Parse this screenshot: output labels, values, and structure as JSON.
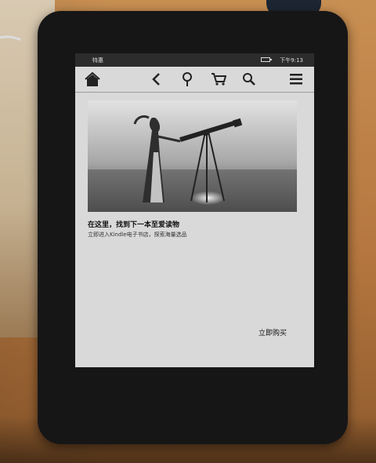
{
  "status_bar": {
    "label_left": "特惠",
    "time": "下午9:13"
  },
  "toolbar": {
    "icons": [
      "home-icon",
      "back-icon",
      "goodreads-icon",
      "cart-icon",
      "search-icon",
      "menu-icon"
    ]
  },
  "promo": {
    "headline": "在这里，找到下一本至爱读物",
    "subline": "立即进入Kindle电子书店，探索海量选品",
    "buy_label": "立即购买"
  },
  "colors": {
    "screen_bg": "#d9d9d9",
    "device_bezel": "#161616",
    "status_bar_bg": "#2c2c2c"
  }
}
